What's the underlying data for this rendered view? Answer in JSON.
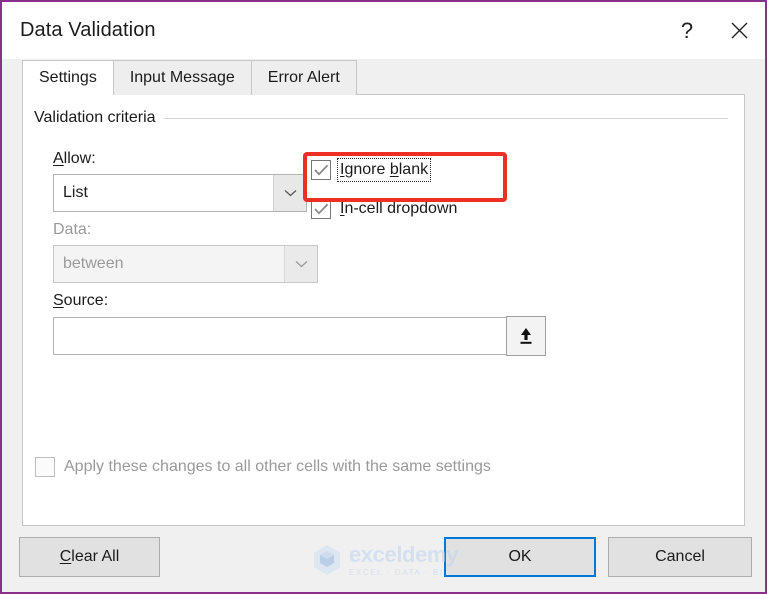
{
  "window": {
    "title": "Data Validation",
    "help_icon": "question-mark-icon",
    "close_icon": "close-icon",
    "border_color": "#8a2f8a"
  },
  "tabs": [
    {
      "label": "Settings",
      "active": true
    },
    {
      "label": "Input Message",
      "active": false
    },
    {
      "label": "Error Alert",
      "active": false
    }
  ],
  "settings": {
    "group_label": "Validation criteria",
    "allow": {
      "label": "Allow:",
      "accel": "A",
      "value": "List",
      "enabled": true,
      "arrow_icon": "chevron-down-icon"
    },
    "data": {
      "label": "Data:",
      "value": "between",
      "enabled": false,
      "arrow_icon": "chevron-down-icon"
    },
    "source": {
      "label": "Source:",
      "accel": "S",
      "value": "",
      "placeholder": "",
      "picker_icon": "range-select-icon"
    },
    "ignore_blank": {
      "label": "Ignore blank",
      "checked": true,
      "focused": true,
      "highlighted": true
    },
    "in_cell_dropdown": {
      "label": "In-cell dropdown",
      "checked": true,
      "focused": false
    },
    "apply_all": {
      "label": "Apply these changes to all other cells with the same settings",
      "checked": false,
      "enabled": false
    }
  },
  "footer": {
    "clear_all": "Clear All",
    "ok": "OK",
    "cancel": "Cancel",
    "default_button": "OK",
    "focus_color": "#0078d7"
  },
  "watermark": {
    "name": "exceldemy",
    "tagline": "EXCEL · DATA · BI",
    "logo_icon": "exceldemy-cube-logo"
  },
  "annotation": {
    "color": "#ed2f25",
    "target": "Ignore blank"
  }
}
